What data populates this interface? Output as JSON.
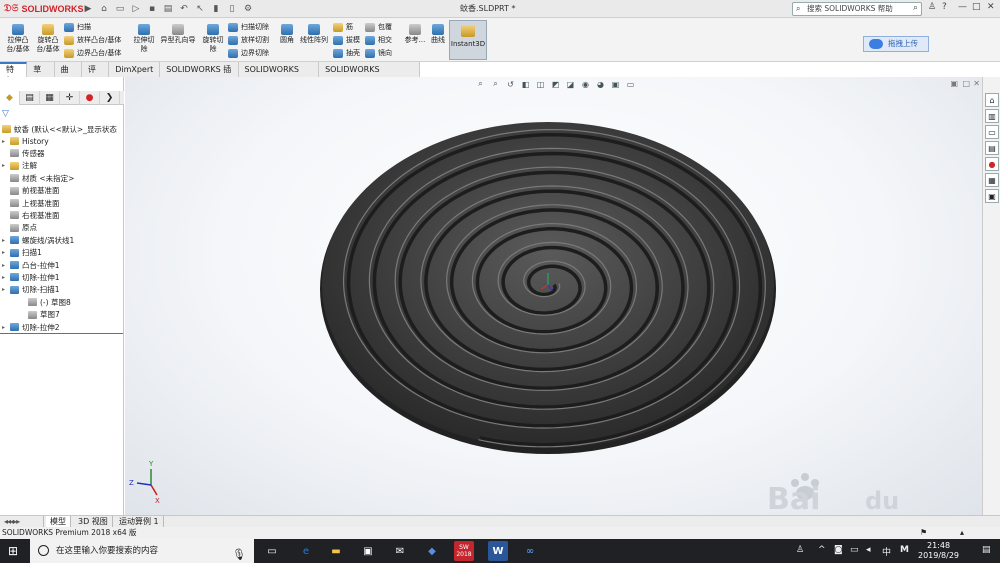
{
  "app": {
    "brand": "SOLIDWORKS",
    "document_title": "蚊香.SLDPRT *",
    "help_search_placeholder": "搜索 SOLIDWORKS 帮助",
    "window_controls": [
      "—",
      "□",
      "✕"
    ]
  },
  "ribbon": {
    "big_buttons": [
      {
        "label": "拉伸凸\n台/基体"
      },
      {
        "label": "旋转凸\n台/基体"
      },
      {
        "label": "拉伸切\n除"
      },
      {
        "label": "异型孔向导"
      },
      {
        "label": "旋转切\n除"
      },
      {
        "label": "圆角"
      },
      {
        "label": "线性阵列"
      },
      {
        "label": "参考..."
      },
      {
        "label": "曲线"
      },
      {
        "label": "Instant3D"
      }
    ],
    "small_buttons": [
      {
        "label": "扫描"
      },
      {
        "label": "放样凸台/基体"
      },
      {
        "label": "边界凸台/基体"
      },
      {
        "label": "扫描切除"
      },
      {
        "label": "放样切割"
      },
      {
        "label": "边界切除"
      },
      {
        "label": "筋"
      },
      {
        "label": "拔模"
      },
      {
        "label": "抽壳"
      },
      {
        "label": "包覆"
      },
      {
        "label": "相交"
      },
      {
        "label": "镜向"
      }
    ],
    "upload_button": "拖拽上传"
  },
  "command_tabs": [
    "特征",
    "草图",
    "曲面",
    "评估",
    "DimXpert",
    "SOLIDWORKS 插件",
    "SOLIDWORKS MBD",
    "SOLIDWORKS Inspection"
  ],
  "feature_tree": {
    "root": "蚊香 (默认<<默认>_显示状态",
    "items": [
      {
        "label": "History",
        "arrow": true
      },
      {
        "label": "传感器",
        "arrow": false
      },
      {
        "label": "注解",
        "arrow": true
      },
      {
        "label": "材质 <未指定>",
        "arrow": false
      },
      {
        "label": "前视基准面",
        "arrow": false
      },
      {
        "label": "上视基准面",
        "arrow": false
      },
      {
        "label": "右视基准面",
        "arrow": false
      },
      {
        "label": "原点",
        "arrow": false
      },
      {
        "label": "螺旋线/涡状线1",
        "arrow": true
      },
      {
        "label": "扫描1",
        "arrow": true
      },
      {
        "label": "凸台-拉伸1",
        "arrow": true
      },
      {
        "label": "切除-拉伸1",
        "arrow": true
      },
      {
        "label": "切除-扫描1",
        "arrow": true
      },
      {
        "label": "(-) 草图8",
        "arrow": false
      },
      {
        "label": "草图7",
        "arrow": false
      },
      {
        "label": "切除-拉伸2",
        "arrow": true
      }
    ]
  },
  "bottom_tabs": [
    "模型",
    "3D 视图",
    "运动算例 1"
  ],
  "status_bar": {
    "text": "SOLIDWORKS Premium 2018 x64 版"
  },
  "triad": {
    "x": "X",
    "y": "Y",
    "z": "Z"
  },
  "taskbar": {
    "search_placeholder": "在这里输入你要搜索的内容",
    "ime": "中",
    "ime2": "M",
    "time": "21:48",
    "date": "2019/8/29",
    "sw_badge": "SW\n2018",
    "word_badge": "W"
  },
  "colors": {
    "accent": "#3a78c4",
    "model": "#3a3a3a",
    "brand": "#d2232a"
  }
}
